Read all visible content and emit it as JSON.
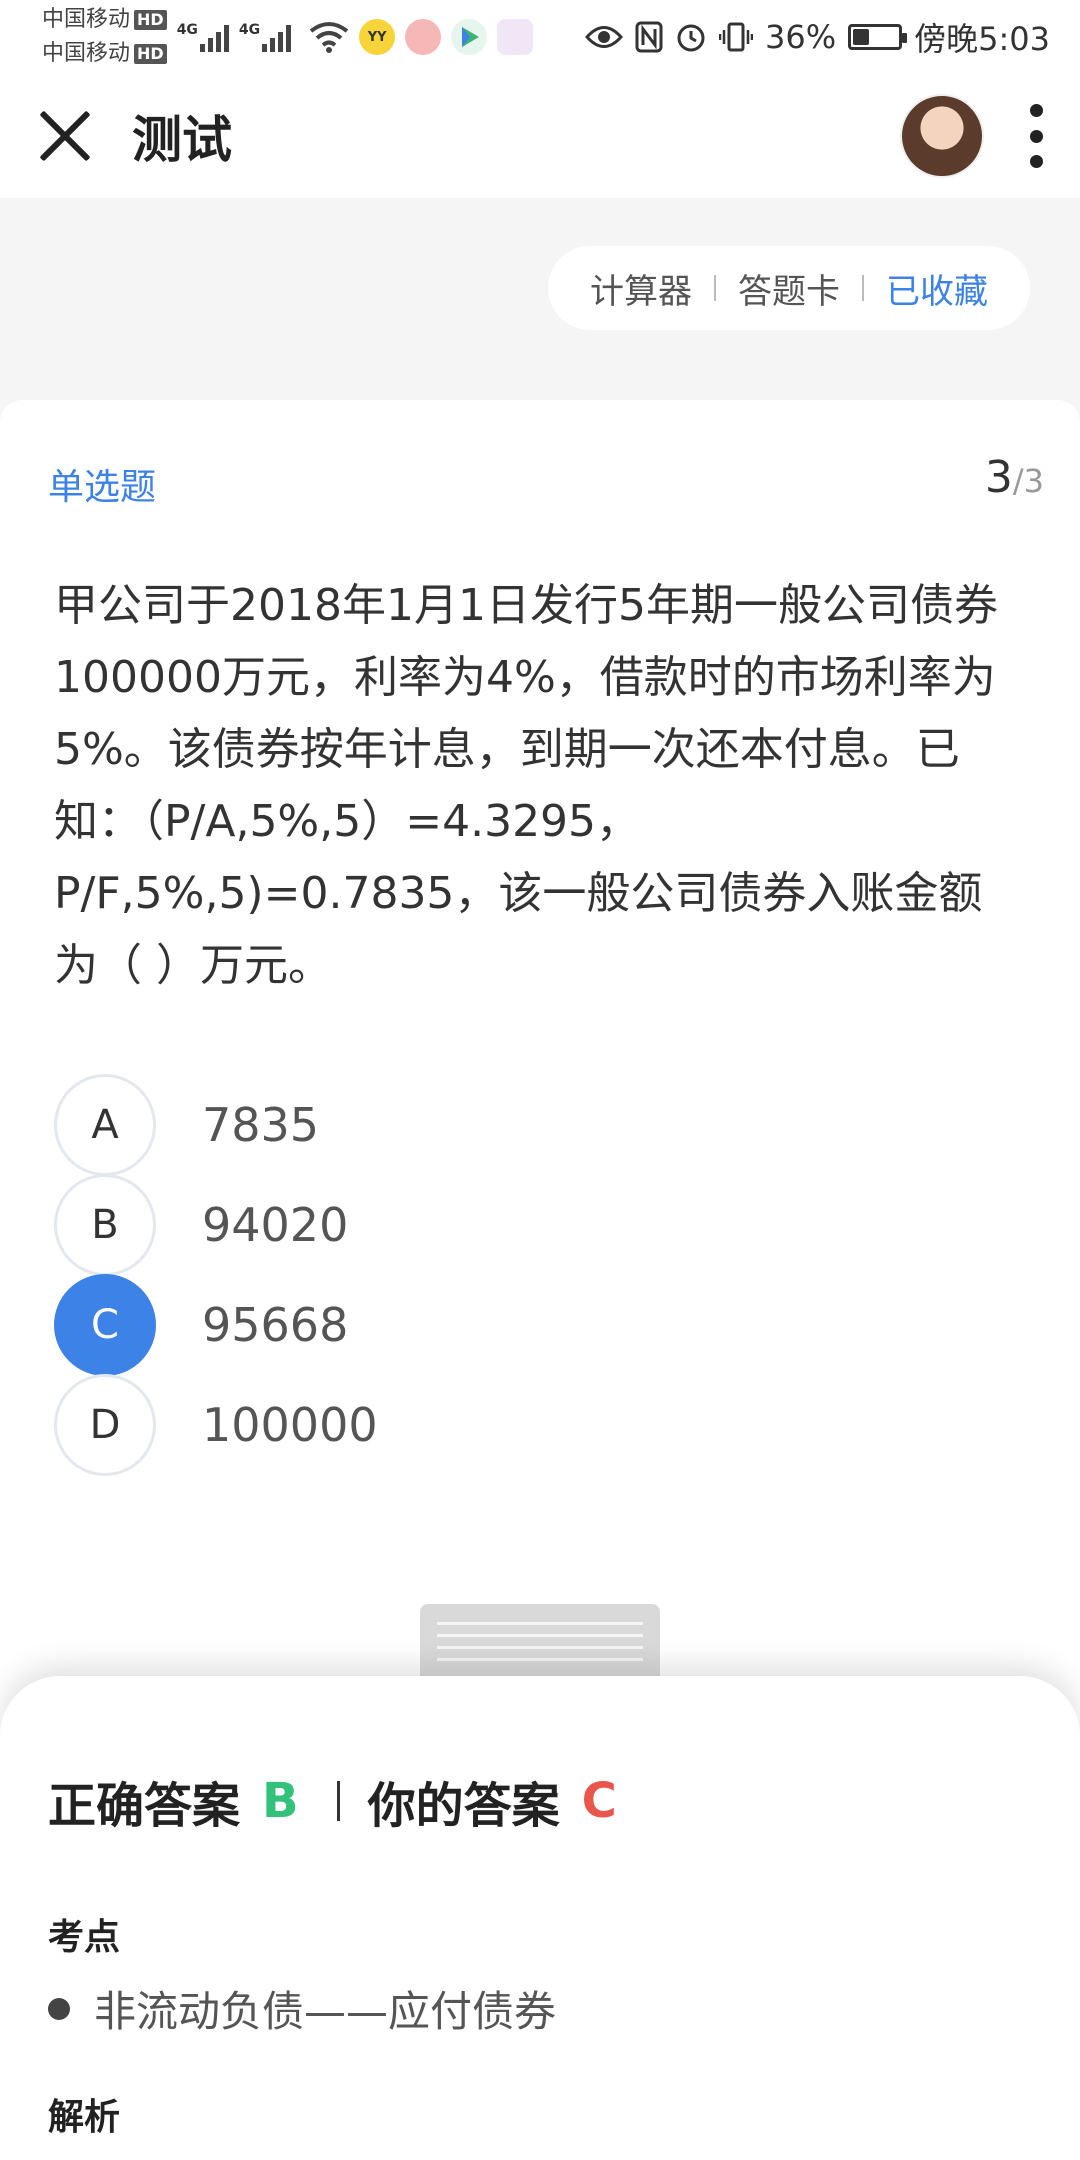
{
  "status_bar": {
    "carrier_1": "中国移动",
    "carrier_2": "中国移动",
    "hd_badge": "HD",
    "network_1": "4G",
    "network_2": "4G",
    "battery": "36%",
    "time": "傍晚5:03",
    "icons": [
      "wifi-icon",
      "yy-app-icon",
      "app-icon",
      "video-app-icon",
      "gallery-app-icon",
      "eye-icon",
      "nfc-icon",
      "alarm-icon",
      "vibrate-icon"
    ]
  },
  "header": {
    "title": "测试"
  },
  "tools": {
    "calculator": "计算器",
    "answer_card": "答题卡",
    "favorited": "已收藏",
    "accent_color": "#3d82e6"
  },
  "question": {
    "type": "单选题",
    "current": "3",
    "total": "/3",
    "text": "甲公司于2018年1月1日发行5年期一般公司债券100000万元，利率为4%，借款时的市场利率为5%。该债券按年计息，到期一次还本付息。已知：（P/A,5%,5）=4.3295，P/F,5%,5)=0.7835，该一般公司债券入账金额为（ ）万元。",
    "options": [
      {
        "letter": "A",
        "value": "7835",
        "selected": false
      },
      {
        "letter": "B",
        "value": "94020",
        "selected": false
      },
      {
        "letter": "C",
        "value": "95668",
        "selected": true
      },
      {
        "letter": "D",
        "value": "100000",
        "selected": false
      }
    ]
  },
  "answer_sheet": {
    "correct_label": "正确答案",
    "correct_value": "B",
    "correct_color": "#32c27a",
    "yours_label": "你的答案",
    "yours_value": "C",
    "yours_color": "#e9564b",
    "knowledge_title": "考点",
    "knowledge_item": "非流动负债——应付债券",
    "analysis_title": "解析"
  }
}
